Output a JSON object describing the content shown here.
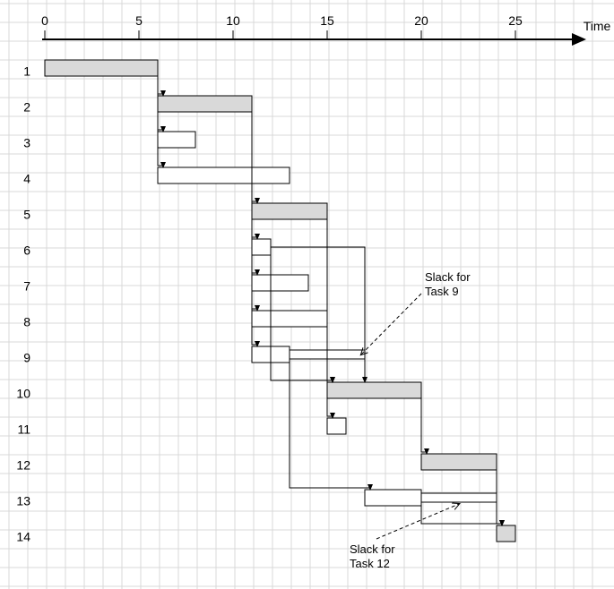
{
  "axis": {
    "label": "Time",
    "ticks": [
      0,
      5,
      10,
      15,
      20,
      25
    ]
  },
  "rows": [
    "1",
    "2",
    "3",
    "4",
    "5",
    "6",
    "7",
    "8",
    "9",
    "10",
    "11",
    "12",
    "13",
    "14"
  ],
  "annotations": {
    "slack9": {
      "l1": "Slack for",
      "l2": "Task 9"
    },
    "slack12": {
      "l1": "Slack for",
      "l2": "Task 12"
    }
  },
  "chart_data": {
    "type": "bar",
    "title": "",
    "xlabel": "Time",
    "ylabel": "",
    "xlim": [
      0,
      28
    ],
    "tasks": [
      {
        "id": 1,
        "start": 0,
        "end": 6,
        "critical": true
      },
      {
        "id": 2,
        "start": 6,
        "end": 11,
        "critical": true
      },
      {
        "id": 3,
        "start": 6,
        "end": 8,
        "critical": false
      },
      {
        "id": 4,
        "start": 6,
        "end": 13,
        "critical": false
      },
      {
        "id": 5,
        "start": 11,
        "end": 15,
        "critical": true
      },
      {
        "id": 6,
        "start": 11,
        "end": 12,
        "critical": false
      },
      {
        "id": 7,
        "start": 11,
        "end": 14,
        "critical": false
      },
      {
        "id": 8,
        "start": 11,
        "end": 15,
        "critical": false
      },
      {
        "id": 9,
        "start": 11,
        "end": 13,
        "critical": false,
        "slack_end": 17
      },
      {
        "id": 10,
        "start": 15,
        "end": 20,
        "critical": true
      },
      {
        "id": 11,
        "start": 15,
        "end": 16,
        "critical": false
      },
      {
        "id": 12,
        "start": 20,
        "end": 24,
        "critical": true
      },
      {
        "id": 13,
        "start": 17,
        "end": 20,
        "critical": false,
        "slack_end": 24
      },
      {
        "id": 14,
        "start": 24,
        "end": 25,
        "critical": true
      }
    ],
    "dependencies": [
      [
        1,
        2
      ],
      [
        1,
        3
      ],
      [
        1,
        4
      ],
      [
        2,
        5
      ],
      [
        2,
        6
      ],
      [
        2,
        7
      ],
      [
        2,
        8
      ],
      [
        2,
        9
      ],
      [
        5,
        10
      ],
      [
        5,
        11
      ],
      [
        6,
        10
      ],
      [
        9,
        13
      ],
      [
        10,
        12
      ],
      [
        12,
        14
      ],
      [
        13,
        14
      ]
    ]
  }
}
